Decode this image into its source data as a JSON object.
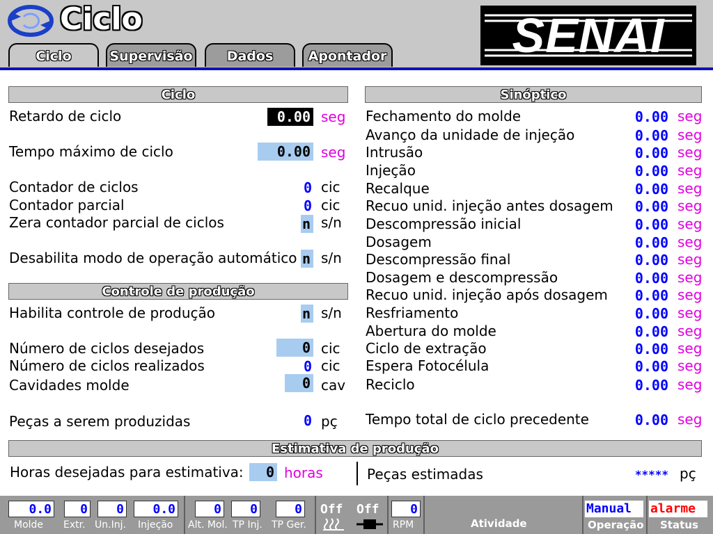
{
  "header": {
    "title": "Ciclo",
    "logo_text": "SENAI",
    "tabs": [
      "Ciclo",
      "Supervisão",
      "Dados",
      "Apontador"
    ]
  },
  "ciclo": {
    "section_title": "Ciclo",
    "retardo": {
      "label": "Retardo de ciclo",
      "value": "0.00",
      "unit": "seg"
    },
    "tempo_max": {
      "label": "Tempo máximo de ciclo",
      "value": "0.00",
      "unit": "seg"
    },
    "contador": {
      "label": "Contador de ciclos",
      "value": "0",
      "unit": "cic"
    },
    "contador_parcial": {
      "label": "Contador parcial",
      "value": "0",
      "unit": "cic"
    },
    "zera": {
      "label": "Zera contador parcial de ciclos",
      "value": "n",
      "unit": "s/n"
    },
    "desabilita": {
      "label": "Desabilita modo de operação automático",
      "value": "n",
      "unit": "s/n"
    }
  },
  "producao": {
    "section_title": "Controle de produção",
    "habilita": {
      "label": "Habilita controle de produção",
      "value": "n",
      "unit": "s/n"
    },
    "desejados": {
      "label": "Número de ciclos desejados",
      "value": "0",
      "unit": "cic"
    },
    "realizados": {
      "label": "Número de ciclos realizados",
      "value": "0",
      "unit": "cic"
    },
    "cavidades": {
      "label": "Cavidades molde",
      "value": "0",
      "unit": "cav"
    },
    "pecas": {
      "label": "Peças a serem produzidas",
      "value": "0",
      "unit": "pç"
    }
  },
  "sinoptico": {
    "section_title": "Sinóptico",
    "unit": "seg",
    "items": [
      {
        "label": "Fechamento do molde",
        "value": "0.00"
      },
      {
        "label": "Avanço da unidade de injeção",
        "value": "0.00"
      },
      {
        "label": "Intrusão",
        "value": "0.00"
      },
      {
        "label": "Injeção",
        "value": "0.00"
      },
      {
        "label": "Recalque",
        "value": "0.00"
      },
      {
        "label": "Recuo unid. injeção antes dosagem",
        "value": "0.00"
      },
      {
        "label": "Descompressão inicial",
        "value": "0.00"
      },
      {
        "label": "Dosagem",
        "value": "0.00"
      },
      {
        "label": "Descompressão final",
        "value": "0.00"
      },
      {
        "label": "Dosagem e descompressão",
        "value": "0.00"
      },
      {
        "label": "Recuo unid. injeção após dosagem",
        "value": "0.00"
      },
      {
        "label": "Resfriamento",
        "value": "0.00"
      },
      {
        "label": "Abertura do molde",
        "value": "0.00"
      },
      {
        "label": "Ciclo de extração",
        "value": "0.00"
      },
      {
        "label": "Espera Fotocélula",
        "value": "0.00"
      },
      {
        "label": "Reciclo",
        "value": "0.00"
      }
    ],
    "total": {
      "label": "Tempo total de ciclo precedente",
      "value": "0.00"
    }
  },
  "estimativa": {
    "section_title": "Estimativa de produção",
    "horas_label": "Horas desejadas para estimativa:",
    "horas_value": "0",
    "horas_unit": "horas",
    "pecas_label": "Peças estimadas",
    "pecas_value": "*****",
    "pecas_unit": "pç"
  },
  "statusbar": {
    "molde": {
      "value": "0.0",
      "label": "Molde"
    },
    "extr": {
      "value": "0",
      "label": "Extr."
    },
    "uninj": {
      "value": "0",
      "label": "Un.Inj."
    },
    "injecao": {
      "value": "0.0",
      "label": "Injeção"
    },
    "altmol": {
      "value": "0",
      "label": "Alt. Mol."
    },
    "tpinj": {
      "value": "0",
      "label": "TP Inj."
    },
    "tpger": {
      "value": "0",
      "label": "TP Ger."
    },
    "off1": "Off",
    "off2": "Off",
    "rpm": {
      "value": "0",
      "label": "RPM"
    },
    "atividade": "Atividade",
    "operacao": {
      "value": "Manual",
      "label": "Operação"
    },
    "status": {
      "value": "alarme",
      "label": "Status"
    }
  },
  "colors": {
    "accent_blue": "#0000ff",
    "unit_magenta": "#e000e0",
    "field_light_blue": "#a8ccf0",
    "alarm_red": "#ff0000",
    "header_bar_blue": "#1010c0"
  }
}
